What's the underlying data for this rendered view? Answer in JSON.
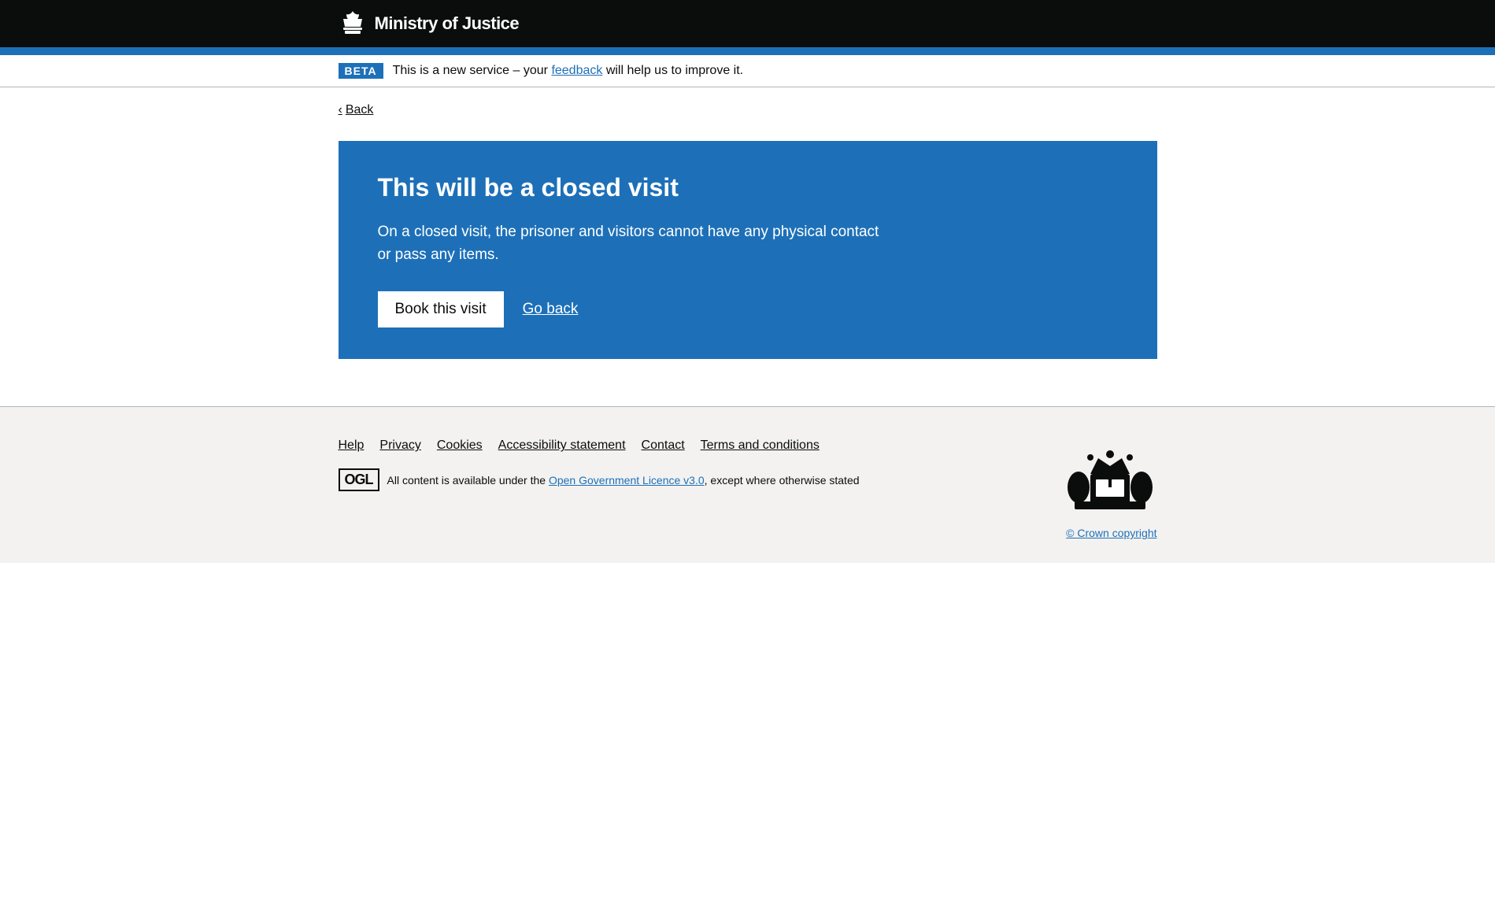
{
  "header": {
    "org_name": "Ministry of Justice",
    "logo_aria": "Ministry of Justice"
  },
  "beta_banner": {
    "tag": "Beta",
    "text_before": "This is a new service – your ",
    "feedback_link": "feedback",
    "text_after": " will help us to improve it."
  },
  "back_link": {
    "label": "Back",
    "chevron": "‹"
  },
  "notification": {
    "title": "This will be a closed visit",
    "body": "On a closed visit, the prisoner and visitors cannot have any physical contact or pass any items.",
    "book_button": "Book this visit",
    "go_back_link": "Go back"
  },
  "footer": {
    "links": [
      {
        "label": "Help",
        "href": "#"
      },
      {
        "label": "Privacy",
        "href": "#"
      },
      {
        "label": "Cookies",
        "href": "#"
      },
      {
        "label": "Accessibility statement",
        "href": "#"
      },
      {
        "label": "Contact",
        "href": "#"
      },
      {
        "label": "Terms and conditions",
        "href": "#"
      }
    ],
    "ogl_logo": "OGL",
    "ogl_text_before": "All content is available under the ",
    "ogl_link": "Open Government Licence v3.0",
    "ogl_text_after": ", except where otherwise stated",
    "copyright": "© Crown copyright"
  }
}
